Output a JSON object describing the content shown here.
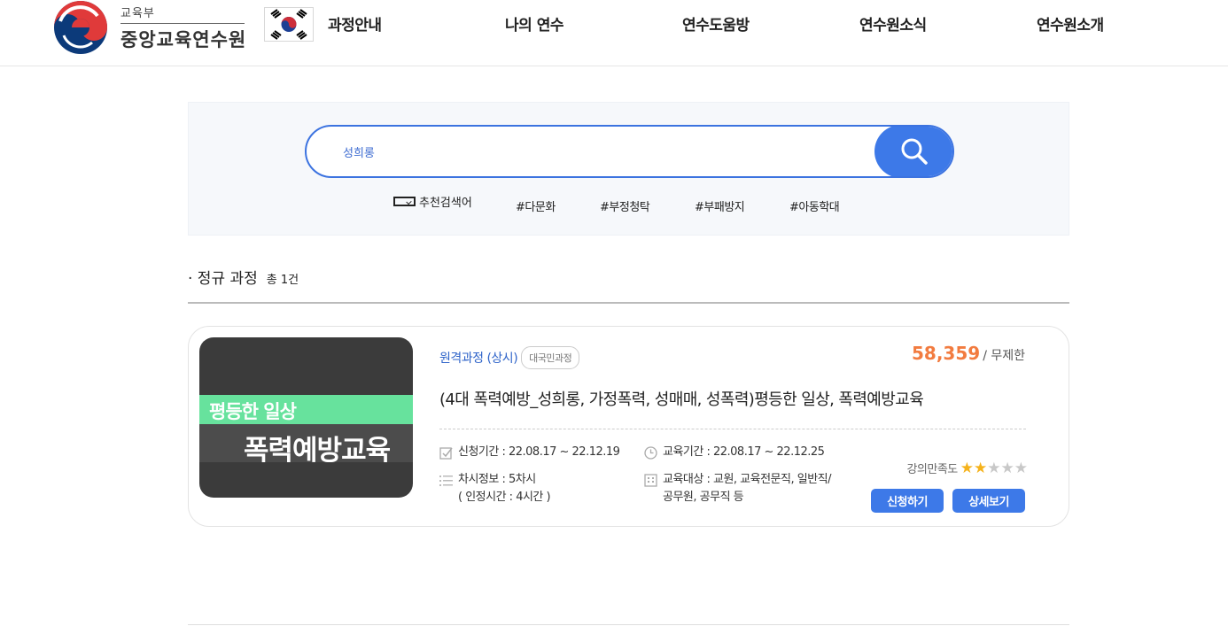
{
  "header": {
    "logo_sub": "교육부",
    "logo_main": "중앙교육연수원",
    "nav": [
      "과정안내",
      "나의 연수",
      "연수도움방",
      "연수원소식",
      "연수원소개"
    ]
  },
  "search": {
    "value": "성희롱",
    "recommend_label": "추천검색어",
    "tags": [
      "#다문화",
      "#부정청탁",
      "#부패방지",
      "#아동학대"
    ]
  },
  "section": {
    "title": "· 정규 과정",
    "count": "총 1건"
  },
  "course": {
    "thumb_line1": "평등한 일상",
    "thumb_line2": "폭력예방교육",
    "type": "원격과정 (상시)",
    "badge": "대국민과정",
    "price": "58,359",
    "price_unit": "/ 무제한",
    "title": "(4대 폭력예방_성희롱, 가정폭력, 성매매, 성폭력)평등한 일상, 폭력예방교육",
    "apply_period": "신청기간 : 22.08.17 ~ 22.12.19",
    "edu_period": "교육기간 : 22.08.17 ~ 22.12.25",
    "session_info": "차시정보 : 5차시",
    "session_time": "( 인정시간 : 4시간 )",
    "target_line1": "교육대상 : 교원, 교육전문직, 일반직/",
    "target_line2": "공무원, 공무직 등",
    "rating_label": "강의만족도",
    "rating": 2,
    "rating_max": 5,
    "apply_button": "신청하기",
    "detail_button": "상세보기"
  },
  "colors": {
    "accent": "#3d79e8",
    "price": "#f27b3f",
    "star_on": "#f5b21b",
    "star_off": "#c8c8c8"
  }
}
